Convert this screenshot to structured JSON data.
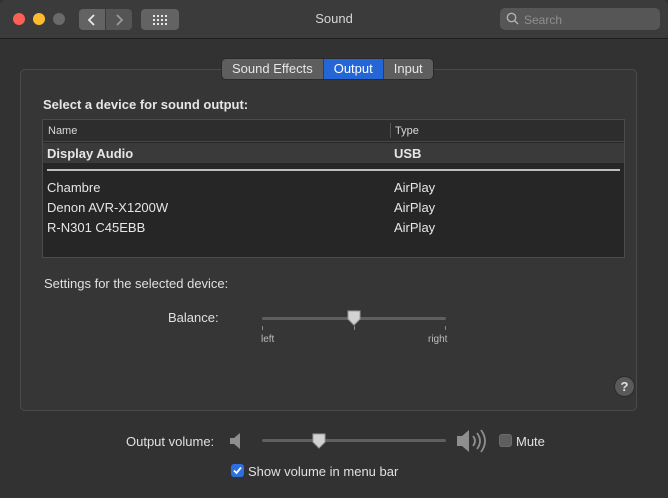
{
  "window": {
    "title": "Sound"
  },
  "toolbar": {
    "back_icon": "chevron-left-icon",
    "forward_icon": "chevron-right-icon",
    "grid_icon": "grid-icon"
  },
  "search": {
    "placeholder": "Search",
    "value": ""
  },
  "tabs": [
    {
      "label": "Sound Effects",
      "active": false
    },
    {
      "label": "Output",
      "active": true
    },
    {
      "label": "Input",
      "active": false
    }
  ],
  "output": {
    "heading": "Select a device for sound output:",
    "columns": {
      "name": "Name",
      "type": "Type"
    },
    "devices": [
      {
        "name": "Display Audio",
        "type": "USB",
        "selected": true
      },
      {
        "name": "Chambre",
        "type": "AirPlay",
        "selected": false
      },
      {
        "name": "Denon AVR-X1200W",
        "type": "AirPlay",
        "selected": false
      },
      {
        "name": "R-N301 C45EBB",
        "type": "AirPlay",
        "selected": false
      }
    ],
    "settings_heading": "Settings for the selected device:",
    "balance": {
      "label": "Balance:",
      "left_label": "left",
      "right_label": "right",
      "value_fraction": 0.5
    },
    "help": "?"
  },
  "volume": {
    "label": "Output volume:",
    "value_fraction": 0.31,
    "low_icon": "speaker-low-icon",
    "high_icon": "speaker-high-icon",
    "mute_label": "Mute",
    "mute_checked": false,
    "show_in_menu_bar_label": "Show volume in menu bar",
    "show_in_menu_bar_checked": true
  },
  "colors": {
    "accent": "#2566d6",
    "close": "#fc5f57",
    "minimize": "#fdbc2e"
  }
}
